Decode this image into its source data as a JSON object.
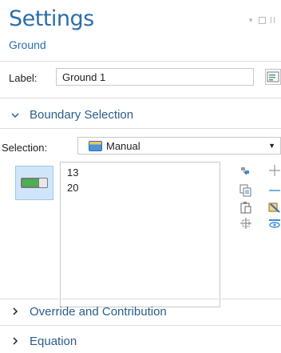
{
  "header": {
    "title": "Settings",
    "subtitle": "Ground"
  },
  "label_row": {
    "label": "Label:",
    "value": "Ground 1"
  },
  "sections": {
    "boundary_selection": "Boundary Selection",
    "override": "Override and Contribution",
    "equation": "Equation"
  },
  "selection": {
    "label": "Selection:",
    "mode": "Manual",
    "items": [
      "13",
      "20"
    ],
    "active_toggle": true
  },
  "icons": {
    "window": [
      "dropdown-icon",
      "maximize-icon",
      "pin-icon"
    ],
    "tools": [
      "copy-selection-icon",
      "paste-selection-icon",
      "clipboard-icon",
      "zoom-to-selection-icon",
      "add-icon",
      "remove-icon",
      "clear-selection-icon",
      "show-selection-icon"
    ]
  },
  "colors": {
    "title": "#2a6ead",
    "section_text": "#2a5e8c",
    "toggle_bg": "#cfe6fa",
    "toggle_on": "#4caf50"
  }
}
